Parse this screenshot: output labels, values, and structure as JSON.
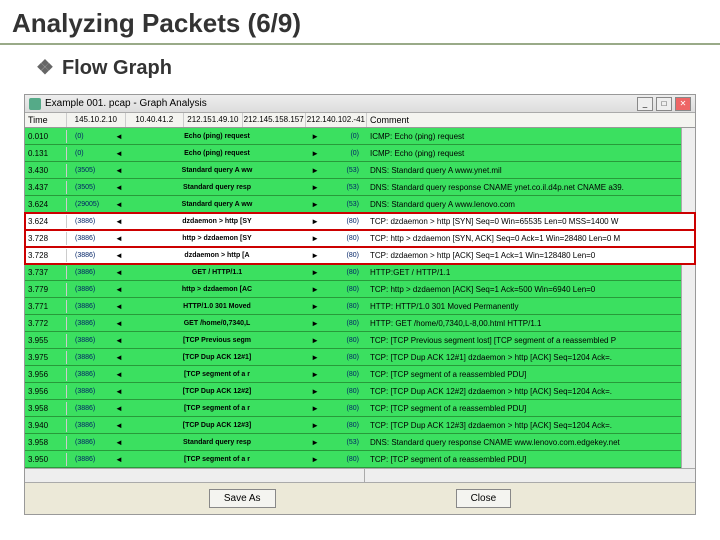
{
  "slide": {
    "title": "Analyzing Packets (6/9)",
    "subtitle": "Flow Graph"
  },
  "window": {
    "title": "Example 001. pcap - Graph Analysis"
  },
  "headers": {
    "time": "Time",
    "ips": [
      "145.10.2.10",
      "10.40.41.2",
      "212.151.49.10",
      "212.145.158.157",
      "212.140.102.-41"
    ],
    "comment": "Comment"
  },
  "rows": [
    {
      "time": "0.010",
      "pl": "(0)",
      "msg": "Echo (ping) request",
      "pr": "(0)",
      "comment": "ICMP: Echo (ping) request",
      "hl": false
    },
    {
      "time": "0.131",
      "pl": "(0)",
      "msg": "Echo (ping) request",
      "pr": "(0)",
      "comment": "ICMP: Echo (ping) request",
      "hl": false
    },
    {
      "time": "3.430",
      "pl": "(3505)",
      "msg": "Standard query A ww",
      "pr": "(53)",
      "comment": "DNS: Standard query A www.ynet.mil",
      "hl": false
    },
    {
      "time": "3.437",
      "pl": "(3505)",
      "msg": "Standard query resp",
      "pr": "(53)",
      "comment": "DNS: Standard query response CNAME ynet.co.il.d4p.net CNAME a39.",
      "hl": false
    },
    {
      "time": "3.624",
      "pl": "(29005)",
      "msg": "Standard query A ww",
      "pr": "(53)",
      "comment": "DNS: Standard query A www.lenovo.com",
      "hl": false
    },
    {
      "time": "3.624",
      "pl": "(3886)",
      "msg": "dzdaemon > http [SY",
      "pr": "(80)",
      "comment": "TCP: dzdaemon > http [SYN] Seq=0 Win=65535 Len=0 MSS=1400 W",
      "hl": true
    },
    {
      "time": "3.728",
      "pl": "(3886)",
      "msg": "http > dzdaemon [SY",
      "pr": "(80)",
      "comment": "TCP: http > dzdaemon [SYN, ACK] Seq=0 Ack=1 Win=28480 Len=0 M",
      "hl": true
    },
    {
      "time": "3.728",
      "pl": "(3886)",
      "msg": "dzdaemon > http [A",
      "pr": "(80)",
      "comment": "TCP: dzdaemon > http [ACK] Seq=1 Ack=1 Win=128480 Len=0",
      "hl": true
    },
    {
      "time": "3.737",
      "pl": "(3886)",
      "msg": "GET / HTTP/1.1",
      "pr": "(80)",
      "comment": "HTTP:GET / HTTP/1.1",
      "hl": false
    },
    {
      "time": "3.779",
      "pl": "(3886)",
      "msg": "http > dzdaemon [AC",
      "pr": "(80)",
      "comment": "TCP: http > dzdaemon [ACK] Seq=1 Ack=500 Win=6940 Len=0",
      "hl": false
    },
    {
      "time": "3.771",
      "pl": "(3886)",
      "msg": "HTTP/1.0 301 Moved",
      "pr": "(80)",
      "comment": "HTTP: HTTP/1.0 301 Moved Permanently",
      "hl": false
    },
    {
      "time": "3.772",
      "pl": "(3886)",
      "msg": "GET /home/0,7340,L",
      "pr": "(80)",
      "comment": "HTTP: GET /home/0,7340,L-8,00.html HTTP/1.1",
      "hl": false
    },
    {
      "time": "3.955",
      "pl": "(3886)",
      "msg": "[TCP Previous segm",
      "pr": "(80)",
      "comment": "TCP: [TCP Previous segment lost] [TCP segment of a reassembled P",
      "hl": false
    },
    {
      "time": "3.975",
      "pl": "(3886)",
      "msg": "[TCP Dup ACK 12#1]",
      "pr": "(80)",
      "comment": "TCP: [TCP Dup ACK 12#1] dzdaemon > http [ACK] Seq=1204 Ack=.",
      "hl": false
    },
    {
      "time": "3.956",
      "pl": "(3886)",
      "msg": "[TCP segment of a r",
      "pr": "(80)",
      "comment": "TCP: [TCP segment of a reassembled PDU]",
      "hl": false
    },
    {
      "time": "3.956",
      "pl": "(3886)",
      "msg": "[TCP Dup ACK 12#2]",
      "pr": "(80)",
      "comment": "TCP: [TCP Dup ACK 12#2] dzdaemon > http [ACK] Seq=1204 Ack=.",
      "hl": false
    },
    {
      "time": "3.958",
      "pl": "(3886)",
      "msg": "[TCP segment of a r",
      "pr": "(80)",
      "comment": "TCP: [TCP segment of a reassembled PDU]",
      "hl": false
    },
    {
      "time": "3.940",
      "pl": "(3886)",
      "msg": "[TCP Dup ACK 12#3]",
      "pr": "(80)",
      "comment": "TCP: [TCP Dup ACK 12#3] dzdaemon > http [ACK] Seq=1204 Ack=.",
      "hl": false
    },
    {
      "time": "3.958",
      "pl": "(3886)",
      "msg": "Standard query resp",
      "pr": "(53)",
      "comment": "DNS: Standard query response CNAME www.lenovo.com.edgekey.net",
      "hl": false
    },
    {
      "time": "3.950",
      "pl": "(3886)",
      "msg": "[TCP segment of a r",
      "pr": "(80)",
      "comment": "TCP: [TCP segment of a reassembled PDU]",
      "hl": false
    }
  ],
  "buttons": {
    "save_as": "Save As",
    "close": "Close"
  }
}
